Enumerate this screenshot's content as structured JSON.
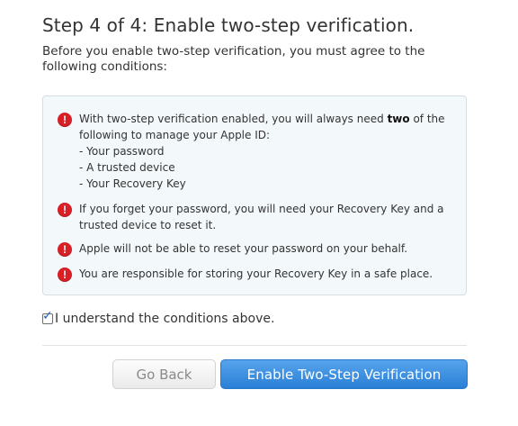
{
  "header": {
    "title": "Step 4 of 4: Enable two-step verification.",
    "intro": "Before you enable two-step verification, you must agree to the following conditions:"
  },
  "conditions": [
    {
      "icon": "warning-icon",
      "lines": [
        {
          "before": "With two-step verification enabled, you will always need ",
          "bold": "two",
          "after": " of the"
        },
        {
          "text": "following to manage your Apple ID:"
        },
        {
          "text": "- Your password"
        },
        {
          "text": "- A trusted device"
        },
        {
          "text": "- Your Recovery Key"
        }
      ]
    },
    {
      "icon": "warning-icon",
      "lines": [
        {
          "text": "If you forget your password, you will need your Recovery Key and a"
        },
        {
          "text": "trusted device to reset it."
        }
      ]
    },
    {
      "icon": "warning-icon",
      "lines": [
        {
          "text": "Apple will not be able to reset your password on your behalf."
        }
      ]
    },
    {
      "icon": "warning-icon",
      "lines": [
        {
          "text": "You are responsible for storing your Recovery Key in a safe place."
        }
      ]
    }
  ],
  "agreement": {
    "checked": true,
    "label": "I understand the conditions above."
  },
  "buttons": {
    "back_label": "Go Back",
    "enable_label": "Enable Two-Step Verification"
  },
  "colors": {
    "warning": "#d81f26",
    "primary_button": "#3a8de0",
    "box_background": "#f3f8fb"
  }
}
